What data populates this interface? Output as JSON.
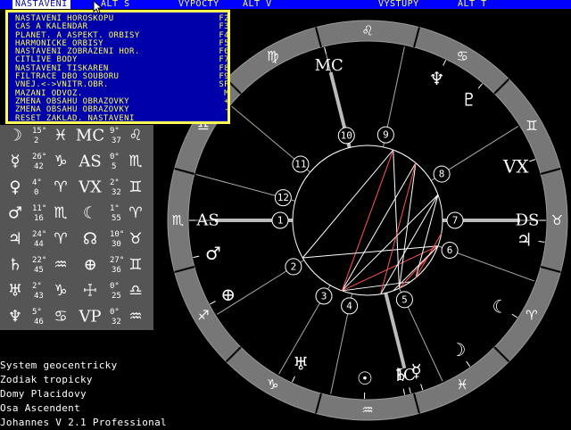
{
  "menu": {
    "items": [
      "NASTAVENI",
      "ALT S",
      "VYPOCTY",
      "ALT V",
      "VYSTUPY",
      "ALT T"
    ]
  },
  "dropdown": {
    "items": [
      {
        "label": "NASTAVENI HOROSKOPU",
        "key": "F2"
      },
      {
        "label": "CAS A KALENDAR",
        "key": "F3"
      },
      {
        "label": "PLANET. A ASPEKT. ORBISY",
        "key": "F4"
      },
      {
        "label": "HARMONICKE ORBISY",
        "key": "F5"
      },
      {
        "label": "NASTAVENI ZOBRAZENI HOR.",
        "key": "F6"
      },
      {
        "label": "CITLIVE BODY",
        "key": "F7"
      },
      {
        "label": "NASTAVENI TISKAREN",
        "key": "F8"
      },
      {
        "label": "FILTRACE DBO SOUBORU",
        "key": "F9"
      },
      {
        "label": "VNEJ.<->VNITR.OBR.",
        "key": "SP"
      },
      {
        "label": "MAZANI ODVOZ.",
        "key": "M"
      },
      {
        "label": "ZMENA OBSAHU OBRAZOVKY",
        "key": "+"
      },
      {
        "label": "ZMENA OBSAHU OBRAZOVKY",
        "key": "-"
      },
      {
        "label": "RESET ZAKLAD. NASTAVENI",
        "key": ""
      }
    ]
  },
  "planets": [
    {
      "glyph": "☽",
      "deg": "15°",
      "min": "2",
      "sign": "♓",
      "glyph2": "MC",
      "deg2": "9°",
      "min2": "37",
      "sign2": "♌"
    },
    {
      "glyph": "☿",
      "deg": "26°",
      "min": "42",
      "sign": "♑",
      "glyph2": "AS",
      "deg2": "0°",
      "min2": "5",
      "sign2": "♏"
    },
    {
      "glyph": "♀",
      "deg": "4°",
      "min": "0",
      "sign": "♈",
      "glyph2": "VX",
      "deg2": "2°",
      "min2": "32",
      "sign2": "♊"
    },
    {
      "glyph": "♂",
      "deg": "11°",
      "min": "16",
      "sign": "♏",
      "glyph2": "☾",
      "deg2": "1°",
      "min2": "55",
      "sign2": "♈"
    },
    {
      "glyph": "♃",
      "deg": "24°",
      "min": "44",
      "sign": "♈",
      "glyph2": "☊",
      "deg2": "10°",
      "min2": "30",
      "sign2": "♉"
    },
    {
      "glyph": "♄",
      "deg": "22°",
      "min": "45",
      "sign": "♒",
      "glyph2": "⊕",
      "deg2": "27°",
      "min2": "36",
      "sign2": "♊"
    },
    {
      "glyph": "♅",
      "deg": "2°",
      "min": "43",
      "sign": "♑",
      "glyph2": "☩",
      "deg2": "0°",
      "min2": "25",
      "sign2": "♎"
    },
    {
      "glyph": "♆",
      "deg": "5°",
      "min": "46",
      "sign": "♋",
      "glyph2": "VP",
      "deg2": "0°",
      "min2": "32",
      "sign2": "♒"
    }
  ],
  "info": {
    "lines": [
      "System geocentricky",
      "Zodiak tropicky",
      "Domy Placidovy",
      "Osa Ascendent",
      "Johannes V 2.1 Professional"
    ]
  },
  "wheel": {
    "signs": [
      {
        "angle": 180,
        "glyph": "♏"
      },
      {
        "angle": 210,
        "glyph": "♐"
      },
      {
        "angle": 240,
        "glyph": "♑"
      },
      {
        "angle": 270,
        "glyph": "♒"
      },
      {
        "angle": 300,
        "glyph": "♓"
      },
      {
        "angle": 330,
        "glyph": "♈"
      },
      {
        "angle": 0,
        "glyph": "♉"
      },
      {
        "angle": 30,
        "glyph": "♊"
      },
      {
        "angle": 60,
        "glyph": "♋"
      },
      {
        "angle": 90,
        "glyph": "♌"
      },
      {
        "angle": 120,
        "glyph": "♍"
      },
      {
        "angle": 150,
        "glyph": "♎"
      }
    ],
    "houses": [
      {
        "num": "1",
        "angle": 180
      },
      {
        "num": "2",
        "angle": 212
      },
      {
        "num": "3",
        "angle": 240
      },
      {
        "num": "4",
        "angle": 258
      },
      {
        "num": "5",
        "angle": 295
      },
      {
        "num": "6",
        "angle": 340
      },
      {
        "num": "7",
        "angle": 0
      },
      {
        "num": "8",
        "angle": 32
      },
      {
        "num": "9",
        "angle": 78
      },
      {
        "num": "10",
        "angle": 104
      },
      {
        "num": "11",
        "angle": 140
      },
      {
        "num": "12",
        "angle": 165
      }
    ],
    "points": [
      {
        "label": "MC",
        "angle": 104,
        "axis": true
      },
      {
        "label": "IC",
        "angle": 284,
        "axis": true
      },
      {
        "label": "AS",
        "angle": 180,
        "axis": true
      },
      {
        "label": "DS",
        "angle": 0,
        "axis": true
      },
      {
        "label": "VX",
        "angle": 20,
        "axis": false
      },
      {
        "label": "♆",
        "angle": 64,
        "axis": false
      },
      {
        "label": "♇",
        "angle": 50,
        "axis": false
      },
      {
        "label": "♃",
        "angle": 353,
        "axis": false
      },
      {
        "label": "☾",
        "angle": 327,
        "axis": false
      },
      {
        "label": "☽",
        "angle": 305,
        "axis": false
      },
      {
        "label": "♄",
        "angle": 282,
        "axis": false
      },
      {
        "label": "☿",
        "angle": 288,
        "axis": false
      },
      {
        "label": "☉",
        "angle": 269,
        "axis": false
      },
      {
        "label": "♅",
        "angle": 245,
        "axis": false
      },
      {
        "label": "⊕",
        "angle": 208,
        "axis": false
      },
      {
        "label": "♂",
        "angle": 192,
        "axis": false
      }
    ],
    "aspects": [
      {
        "from": 250,
        "to": 50,
        "color": "#ffffff"
      },
      {
        "from": 250,
        "to": 20,
        "color": "#ffffff"
      },
      {
        "from": 250,
        "to": 340,
        "color": "#ff5555"
      },
      {
        "from": 250,
        "to": 305,
        "color": "#ffffff"
      },
      {
        "from": 295,
        "to": 50,
        "color": "#ffffff"
      },
      {
        "from": 295,
        "to": 70,
        "color": "#ffffff"
      },
      {
        "from": 295,
        "to": 340,
        "color": "#ff5555"
      },
      {
        "from": 70,
        "to": 250,
        "color": "#ff5555"
      },
      {
        "from": 70,
        "to": 210,
        "color": "#ffffff"
      },
      {
        "from": 210,
        "to": 340,
        "color": "#ffffff"
      },
      {
        "from": 280,
        "to": 50,
        "color": "#ff5555"
      },
      {
        "from": 280,
        "to": 20,
        "color": "#ffffff"
      },
      {
        "from": 310,
        "to": 20,
        "color": "#ffffff"
      },
      {
        "from": 310,
        "to": 350,
        "color": "#ff5555"
      },
      {
        "from": 290,
        "to": 340,
        "color": "#ffffff"
      }
    ]
  }
}
